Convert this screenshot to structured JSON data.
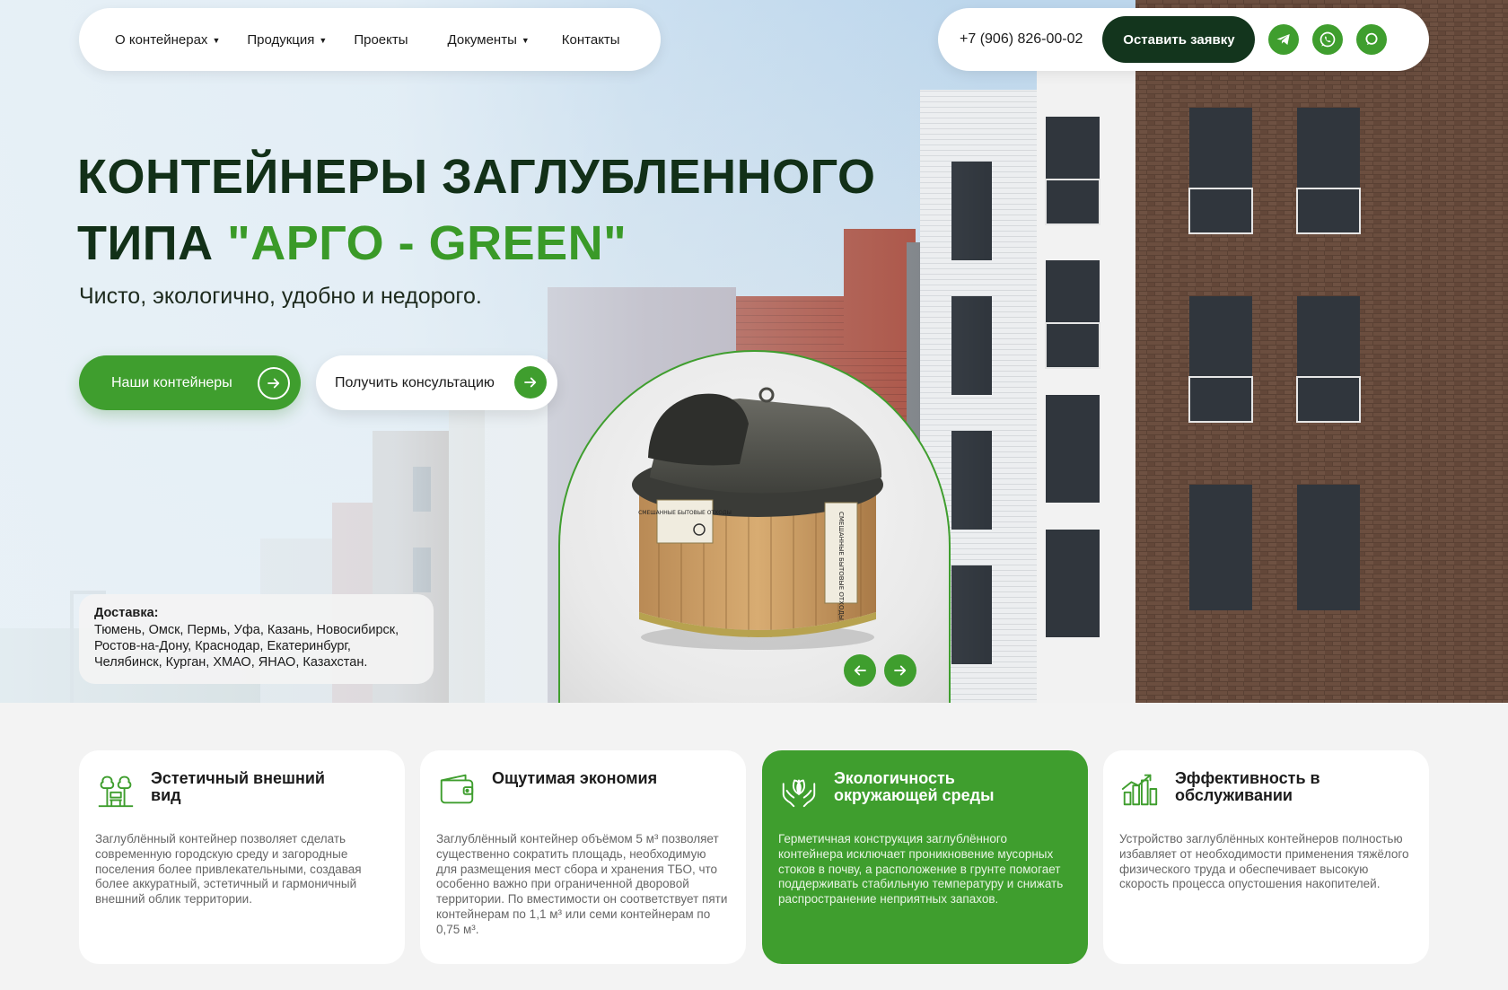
{
  "nav": {
    "items": [
      {
        "label": "О контейнерах",
        "dropdown": true
      },
      {
        "label": "Продукция",
        "dropdown": true
      },
      {
        "label": "Проекты",
        "dropdown": false
      },
      {
        "label": "Документы",
        "dropdown": true
      },
      {
        "label": "Контакты",
        "dropdown": false
      }
    ]
  },
  "contact": {
    "phone": "+7 (906) 826-00-02",
    "cta_label": "Оставить заявку",
    "socials": [
      "telegram-icon",
      "whatsapp-icon",
      "chat-icon"
    ]
  },
  "hero": {
    "title_line1": "КОНТЕЙНЕРЫ ЗАГЛУБЛЕННОГО",
    "title_line2_prefix": "ТИПА ",
    "title_line2_accent": "\"АРГО - GREEN\"",
    "subtitle": "Чисто, экологично, удобно и недорого.",
    "btn_primary": "Наши контейнеры",
    "btn_secondary": "Получить консультацию"
  },
  "delivery": {
    "title": "Доставка:",
    "text": "Тюмень, Омск, Пермь, Уфа, Казань, Новосибирск, Ростов-на-Дону, Краснодар, Екатеринбург, Челябинск, Курган, ХМАО, ЯНАО, Казахстан."
  },
  "product": {
    "label_front": "СМЕШАННЫЕ БЫТОВЫЕ ОТХОДЫ",
    "label_side": "СМЕШАННЫЕ БЫТОВЫЕ ОТХОДЫ"
  },
  "features": [
    {
      "title": "Эстетичный внешний вид",
      "text": "Заглублённый контейнер позволяет сделать современную городскую среду и загородные поселения более привлекательными, создавая более аккуратный, эстетичный и гармоничный внешний облик территории.",
      "active": false
    },
    {
      "title": "Ощутимая экономия",
      "text": "Заглублённый контейнер объёмом 5 м³ позволяет существенно сократить площадь, необходимую для размещения мест сбора и хранения ТБО, что особенно важно при ограниченной дворовой территории. По вместимости он соответствует пяти контейнерам по 1,1 м³ или семи контейнерам по 0,75 м³.",
      "active": false
    },
    {
      "title": "Экологичность окружающей среды",
      "text": "Герметичная конструкция заглублённого контейнера исключает проникновение мусорных стоков в почву, а расположение в грунте помогает поддерживать стабильную температуру и снижать распространение неприятных запахов.",
      "active": true
    },
    {
      "title": "Эффективность в обслуживании",
      "text": "Устройство заглублённых контейнеров полностью избавляет от необходимости применения тяжёлого физического труда и обеспечивает высокую скорость процесса опустошения накопителей.",
      "active": false
    }
  ],
  "colors": {
    "accent": "#3f9e2e",
    "dark": "#13351d",
    "headline": "#123018"
  }
}
